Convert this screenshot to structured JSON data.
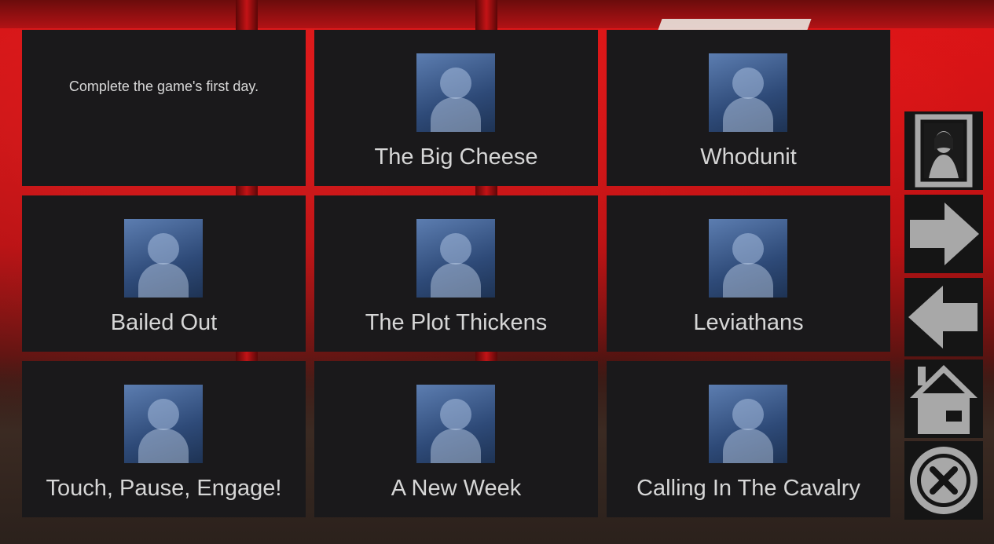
{
  "achievements": {
    "tiles": [
      {
        "description": "Complete the game's first day.",
        "title": ""
      },
      {
        "title": "The Big Cheese"
      },
      {
        "title": "Whodunit"
      },
      {
        "title": "Bailed Out"
      },
      {
        "title": "The Plot Thickens"
      },
      {
        "title": "Leviathans"
      },
      {
        "title": "Touch, Pause, Engage!"
      },
      {
        "title": "A New Week"
      },
      {
        "title": "Calling In The Cavalry"
      }
    ]
  },
  "sidebar": {
    "buttons": [
      {
        "icon": "gallery-portrait-icon"
      },
      {
        "icon": "arrow-right-icon"
      },
      {
        "icon": "arrow-left-icon"
      },
      {
        "icon": "home-icon"
      },
      {
        "icon": "close-icon"
      }
    ]
  },
  "colors": {
    "tile_bg": "#1a191b",
    "text": "#d6d6d6",
    "icon_gray": "#a8a8a8",
    "thumb_tint": "#3f5f93",
    "scene_red": "#c90f12"
  }
}
